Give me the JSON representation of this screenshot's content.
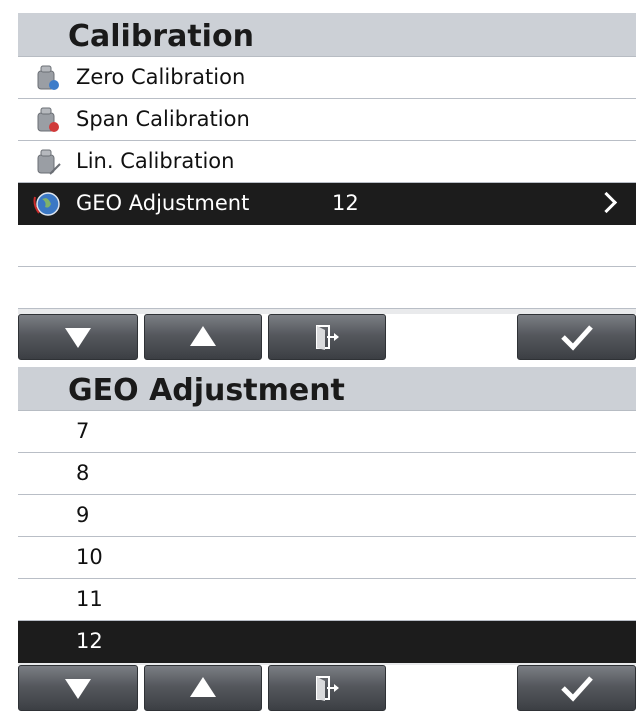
{
  "calibration": {
    "title": "Calibration",
    "items": [
      {
        "label": "Zero Calibration",
        "icon": "weight-zero-icon"
      },
      {
        "label": "Span Calibration",
        "icon": "weight-span-icon"
      },
      {
        "label": "Lin. Calibration",
        "icon": "weight-linearity-icon"
      },
      {
        "label": "GEO Adjustment",
        "value": "12",
        "icon": "globe-icon",
        "selected": true
      }
    ]
  },
  "geo_adjustment": {
    "title": "GEO Adjustment",
    "options": [
      "7",
      "8",
      "9",
      "10",
      "11",
      "12"
    ],
    "selected": "12"
  },
  "buttons": {
    "down": "down-arrow-icon",
    "up": "up-arrow-icon",
    "exit": "exit-door-icon",
    "accept": "checkmark-icon"
  },
  "colors": {
    "title_bar": "#ccd0d6",
    "selected_row": "#1c1c1c",
    "button": "#55585d"
  }
}
